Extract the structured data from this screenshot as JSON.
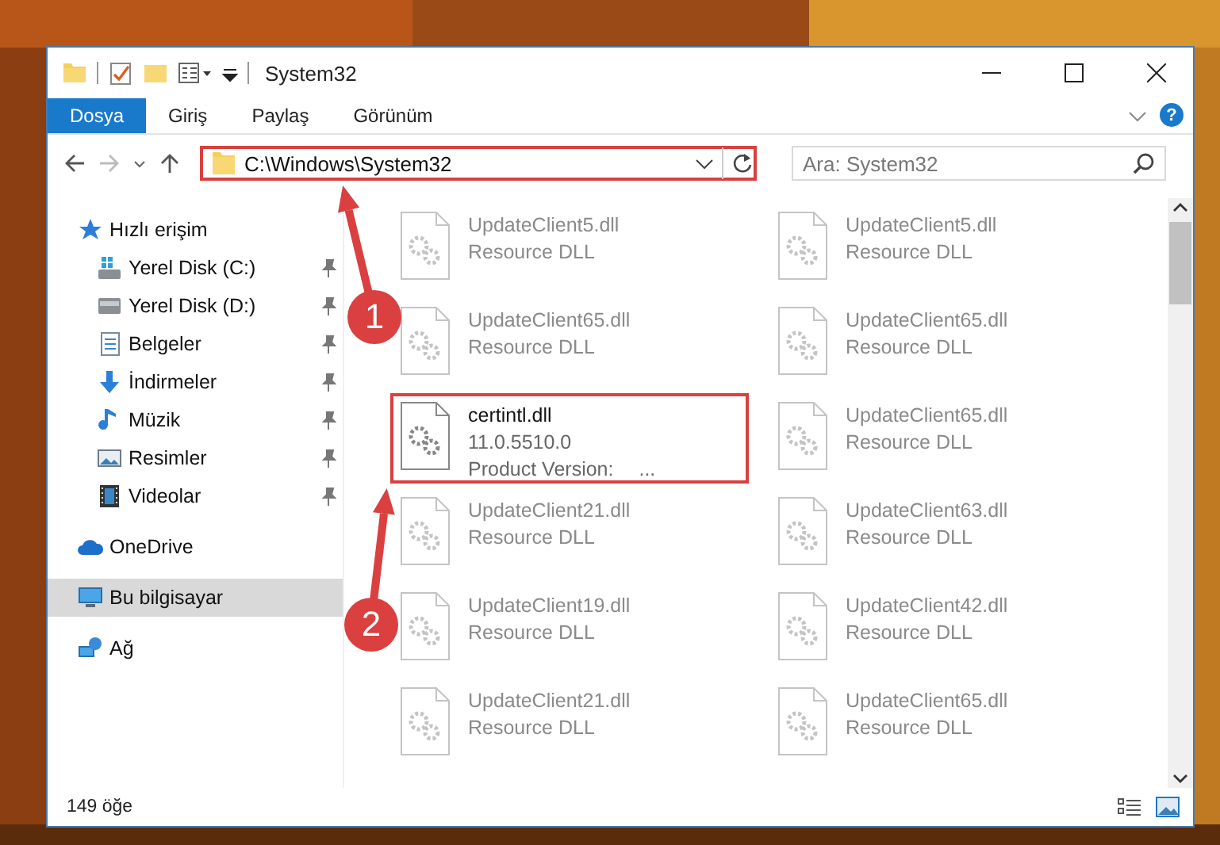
{
  "window": {
    "title": "System32"
  },
  "ribbon": {
    "tabs": [
      {
        "label": "Dosya",
        "selected": true
      },
      {
        "label": "Giriş",
        "selected": false
      },
      {
        "label": "Paylaş",
        "selected": false
      },
      {
        "label": "Görünüm",
        "selected": false
      }
    ],
    "help": "?"
  },
  "address_bar": {
    "path": "C:\\Windows\\System32",
    "highlighted": true
  },
  "search": {
    "placeholder": "Ara: System32"
  },
  "nav": {
    "items": [
      {
        "label": "Hızlı erişim",
        "kind": "star",
        "selected": false,
        "children": [
          {
            "label": "Yerel Disk (C:)",
            "kind": "drive-windows",
            "pinned": true,
            "selected": false
          },
          {
            "label": "Yerel Disk (D:)",
            "kind": "drive",
            "pinned": true,
            "selected": false
          },
          {
            "label": "Belgeler",
            "kind": "document",
            "pinned": true,
            "selected": false
          },
          {
            "label": "İndirmeler",
            "kind": "download",
            "pinned": true,
            "selected": false
          },
          {
            "label": "Müzik",
            "kind": "music",
            "pinned": true,
            "selected": false
          },
          {
            "label": "Resimler",
            "kind": "pictures",
            "pinned": true,
            "selected": false
          },
          {
            "label": "Videolar",
            "kind": "video",
            "pinned": true,
            "selected": false
          }
        ]
      },
      {
        "label": "OneDrive",
        "kind": "cloud",
        "selected": false
      },
      {
        "label": "Bu bilgisayar",
        "kind": "computer",
        "selected": true
      },
      {
        "label": "Ağ",
        "kind": "network",
        "selected": false
      }
    ]
  },
  "files": [
    {
      "name": "UpdateClient5.dll",
      "description": "Resource DLL",
      "blurred": true,
      "highlighted": false
    },
    {
      "name": "UpdateClient5.dll",
      "description": "Resource DLL",
      "blurred": true,
      "highlighted": false
    },
    {
      "name": "UpdateClient65.dll",
      "description": "Resource DLL",
      "blurred": true,
      "highlighted": false
    },
    {
      "name": "UpdateClient65.dll",
      "description": "Resource DLL",
      "blurred": true,
      "highlighted": false
    },
    {
      "name": "certintl.dll",
      "version": "11.0.5510.0",
      "detail_label": "Product Version:",
      "detail_value": "...",
      "blurred": false,
      "highlighted": true
    },
    {
      "name": "UpdateClient65.dll",
      "description": "Resource DLL",
      "blurred": true,
      "highlighted": false
    },
    {
      "name": "UpdateClient21.dll",
      "description": "Resource DLL",
      "blurred": true,
      "highlighted": false
    },
    {
      "name": "UpdateClient63.dll",
      "description": "Resource DLL",
      "blurred": true,
      "highlighted": false
    },
    {
      "name": "UpdateClient19.dll",
      "description": "Resource DLL",
      "blurred": true,
      "highlighted": false
    },
    {
      "name": "UpdateClient42.dll",
      "description": "Resource DLL",
      "blurred": true,
      "highlighted": false
    },
    {
      "name": "UpdateClient21.dll",
      "description": "Resource DLL",
      "blurred": true,
      "highlighted": false
    },
    {
      "name": "UpdateClient65.dll",
      "description": "Resource DLL",
      "blurred": true,
      "highlighted": false
    }
  ],
  "status_bar": {
    "count": "149 öğe"
  },
  "annotations": [
    {
      "number": "1"
    },
    {
      "number": "2"
    }
  ]
}
